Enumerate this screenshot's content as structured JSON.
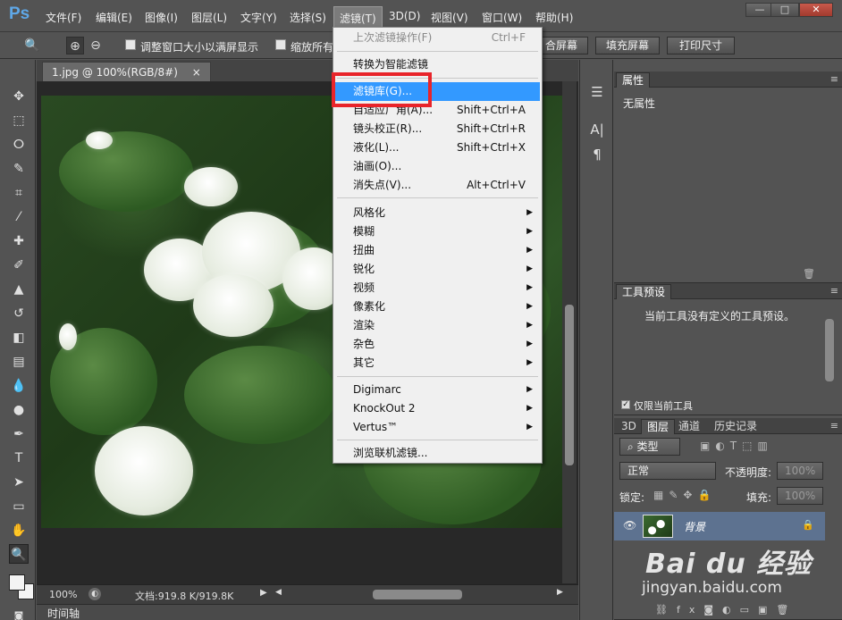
{
  "app": {
    "logo": "Ps"
  },
  "menubar": {
    "items": [
      "文件(F)",
      "编辑(E)",
      "图像(I)",
      "图层(L)",
      "文字(Y)",
      "选择(S)",
      "滤镜(T)",
      "3D(D)",
      "视图(V)",
      "窗口(W)",
      "帮助(H)"
    ],
    "active": "滤镜(T)",
    "window_controls": [
      "—",
      "□",
      "✕"
    ]
  },
  "options": {
    "resize_windows": "调整窗口大小以满屏显示",
    "zoom_all": "缩放所有",
    "fit_screen": "合屏幕",
    "fill_screen": "填充屏幕",
    "print_size": "打印尺寸"
  },
  "document": {
    "tab_title": "1.jpg @ 100%(RGB/8#)",
    "tab_close": "×",
    "zoom": "100%",
    "doc_info": "文档:919.8 K/919.8K"
  },
  "timeline_label": "时间轴",
  "filter_menu": {
    "last_filter": {
      "label": "上次滤镜操作(F)",
      "shortcut": "Ctrl+F"
    },
    "smart": "转换为智能滤镜",
    "group1": [
      {
        "label": "滤镜库(G)...",
        "shortcut": ""
      },
      {
        "label": "自适应广角(A)...",
        "shortcut": "Shift+Ctrl+A"
      },
      {
        "label": "镜头校正(R)...",
        "shortcut": "Shift+Ctrl+R"
      },
      {
        "label": "液化(L)...",
        "shortcut": "Shift+Ctrl+X"
      },
      {
        "label": "油画(O)...",
        "shortcut": ""
      },
      {
        "label": "消失点(V)...",
        "shortcut": "Alt+Ctrl+V"
      }
    ],
    "group2": [
      "风格化",
      "模糊",
      "扭曲",
      "锐化",
      "视频",
      "像素化",
      "渲染",
      "杂色",
      "其它"
    ],
    "group3": [
      "Digimarc",
      "KnockOut 2",
      "Vertus™"
    ],
    "browse": "浏览联机滤镜..."
  },
  "properties_panel": {
    "tab": "属性",
    "content": "无属性"
  },
  "tool_presets_panel": {
    "tab": "工具预设",
    "message": "当前工具没有定义的工具预设。",
    "current_tool_only": "仅限当前工具"
  },
  "layers_panel": {
    "tabs": [
      "3D",
      "图层",
      "通道",
      "历史记录"
    ],
    "filter_kind": "类型",
    "blend_mode": "正常",
    "opacity_label": "不透明度:",
    "opacity_value": "100%",
    "lock_label": "锁定:",
    "fill_label": "填充:",
    "fill_value": "100%",
    "layer_name": "背景"
  },
  "watermark": {
    "logo": "Bai du 经验",
    "url": "jingyan.baidu.com"
  }
}
